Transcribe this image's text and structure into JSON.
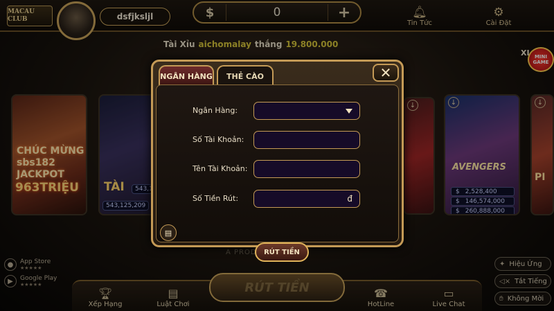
{
  "header": {
    "logo_text": "MACAU CLUB",
    "username": "dsfjksljl",
    "balance": {
      "currency_symbol": "$",
      "value": "0",
      "add_symbol": "+"
    },
    "nav": [
      {
        "label": "Tin Tức",
        "icon": "bell-icon"
      },
      {
        "label": "Cài Đặt",
        "icon": "gear-icon"
      }
    ]
  },
  "ticker": {
    "game": "Tài Xỉu",
    "player": "aichomalay",
    "verb": "thắng",
    "amount": "19.800.000"
  },
  "cards": {
    "card1": {
      "line1": "CHÚC MỪNG",
      "line2": "sbs182",
      "line3": "JACKPOT",
      "amount": "963TRIỆU"
    },
    "card2": {
      "title": "TÀI",
      "value1": "543,125,209",
      "value2": "543,1"
    },
    "card4": {
      "title": "AVENGERS",
      "jackpots": [
        "2,528,400",
        "146,574,000",
        "260,888,000"
      ]
    },
    "card5": {
      "title": "PI"
    }
  },
  "mini_game": {
    "line1": "MINI",
    "line2": "GAME",
    "prefix": "XI"
  },
  "product_text": "A PRODUCT OF",
  "stores": [
    {
      "label": "App Store",
      "rating": "★★★★★",
      "icon": "apple-icon"
    },
    {
      "label": "Google Play",
      "rating": "★★★★★",
      "icon": "play-icon"
    }
  ],
  "toggles": [
    {
      "label": "Hiệu Ứng",
      "icon": "effect-icon"
    },
    {
      "label": "Tắt Tiếng",
      "icon": "mute-icon"
    },
    {
      "label": "Không Mời",
      "icon": "hand-icon"
    }
  ],
  "bottom_nav": {
    "items": [
      {
        "label": "Xếp Hạng",
        "icon": "trophy-icon"
      },
      {
        "label": "Luật Chơi",
        "icon": "rules-icon"
      },
      {
        "label": "HotLine",
        "icon": "phone-icon"
      },
      {
        "label": "Live Chat",
        "icon": "chat-icon"
      }
    ],
    "center_label": "RÚT TIỀN"
  },
  "modal": {
    "tabs": [
      "NGÂN HÀNG",
      "THẺ CÀO"
    ],
    "active_tab": "NGÂN HÀNG",
    "close_symbol": "✕",
    "fields": [
      {
        "label": "Ngân Hàng:",
        "value": "",
        "type": "select"
      },
      {
        "label": "Số Tài Khoản:",
        "value": ""
      },
      {
        "label": "Tên Tài Khoản:",
        "value": ""
      },
      {
        "label": "Số Tiền Rút:",
        "value": "",
        "suffix": "đ"
      }
    ],
    "submit_label": "RÚT TIỀN"
  }
}
